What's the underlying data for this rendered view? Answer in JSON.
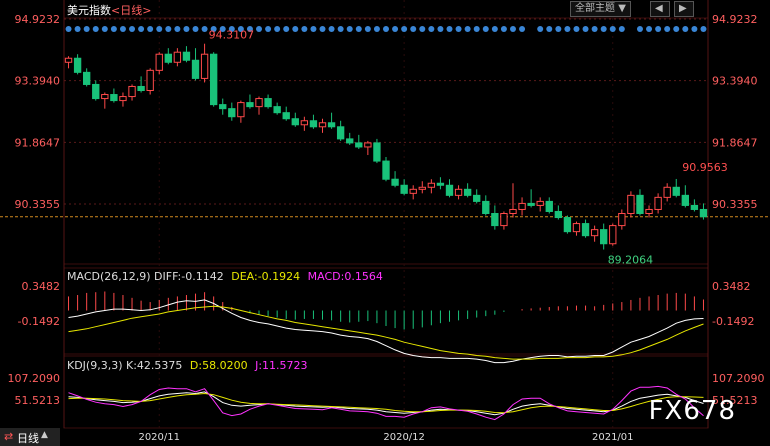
{
  "header": {
    "title": "美元指数",
    "period": "<日线>",
    "theme_button": "全部主题",
    "theme_arrow": "▼"
  },
  "period_tab": "日线",
  "watermark": "FX678",
  "axis_dates": [
    "2020/11",
    "2020/12",
    "2021/01"
  ],
  "price_panel": {
    "ticks": [
      "94.9232",
      "93.3940",
      "91.8647",
      "90.3355"
    ],
    "ymax_label": 94.9232,
    "ymin_label": 90.3355,
    "high_label": "94.3107",
    "high_value": 94.3107,
    "low_label": "89.2064",
    "low_value": 89.2064,
    "recent_high_label": "90.9563",
    "recent_high_value": 90.9563,
    "last_close": 90.02
  },
  "macd_panel": {
    "title": "MACD(26,12,9)",
    "diff_label": "DIFF:-0.1142",
    "dea_label": "DEA:-0.1924",
    "macd_label": "MACD:0.1564",
    "ticks": [
      "0.3482",
      "-0.1492"
    ]
  },
  "kdj_panel": {
    "title": "KDJ(9,3,3)",
    "k_label": "K:42.5375",
    "d_label": "D:58.0200",
    "j_label": "J:11.5723",
    "ticks": [
      "107.2090",
      "51.5213"
    ]
  },
  "colors": {
    "up": "#ff4a4a",
    "down": "#19c27a",
    "axis_text": "#ff5f5f",
    "grid": "#5a1a1a",
    "diff": "#ffffff",
    "dea": "#e6e600",
    "macd": "#ff33ff",
    "marker": "#3a86d6"
  },
  "chart_data": {
    "type": "candlestick",
    "title": "美元指数 日线",
    "xlabel": "",
    "ylabel": "",
    "ylim": [
      89.0,
      94.92
    ],
    "x_ticks": [
      "2020/11",
      "2020/12",
      "2021/01"
    ],
    "ohlc": [
      [
        93.85,
        94.0,
        93.7,
        93.95
      ],
      [
        93.95,
        94.05,
        93.55,
        93.6
      ],
      [
        93.6,
        93.7,
        93.25,
        93.3
      ],
      [
        93.3,
        93.4,
        92.9,
        92.95
      ],
      [
        92.95,
        93.1,
        92.7,
        93.05
      ],
      [
        93.05,
        93.2,
        92.85,
        92.9
      ],
      [
        92.9,
        93.1,
        92.75,
        93.0
      ],
      [
        93.0,
        93.3,
        92.9,
        93.25
      ],
      [
        93.25,
        93.5,
        93.1,
        93.15
      ],
      [
        93.15,
        93.7,
        93.05,
        93.65
      ],
      [
        93.65,
        94.1,
        93.55,
        94.05
      ],
      [
        94.05,
        94.2,
        93.8,
        93.85
      ],
      [
        93.85,
        94.2,
        93.75,
        94.1
      ],
      [
        94.1,
        94.25,
        93.85,
        93.9
      ],
      [
        93.9,
        94.2,
        93.4,
        93.45
      ],
      [
        93.45,
        94.3107,
        93.35,
        94.05
      ],
      [
        94.05,
        94.1,
        92.75,
        92.8
      ],
      [
        92.8,
        92.95,
        92.55,
        92.7
      ],
      [
        92.7,
        92.85,
        92.4,
        92.5
      ],
      [
        92.5,
        92.9,
        92.35,
        92.85
      ],
      [
        92.85,
        93.05,
        92.7,
        92.75
      ],
      [
        92.75,
        93.0,
        92.55,
        92.95
      ],
      [
        92.95,
        93.05,
        92.7,
        92.75
      ],
      [
        92.75,
        92.85,
        92.55,
        92.6
      ],
      [
        92.6,
        92.75,
        92.4,
        92.45
      ],
      [
        92.45,
        92.6,
        92.25,
        92.3
      ],
      [
        92.3,
        92.5,
        92.15,
        92.4
      ],
      [
        92.4,
        92.55,
        92.2,
        92.25
      ],
      [
        92.25,
        92.45,
        92.1,
        92.35
      ],
      [
        92.35,
        92.6,
        92.2,
        92.25
      ],
      [
        92.25,
        92.4,
        91.9,
        91.95
      ],
      [
        91.95,
        92.1,
        91.8,
        91.85
      ],
      [
        91.85,
        92.05,
        91.7,
        91.75
      ],
      [
        91.75,
        91.9,
        91.55,
        91.85
      ],
      [
        91.85,
        91.95,
        91.35,
        91.4
      ],
      [
        91.4,
        91.5,
        90.9,
        90.95
      ],
      [
        90.95,
        91.15,
        90.75,
        90.8
      ],
      [
        90.8,
        90.95,
        90.55,
        90.6
      ],
      [
        90.6,
        90.8,
        90.45,
        90.7
      ],
      [
        90.7,
        90.9,
        90.6,
        90.75
      ],
      [
        90.75,
        90.95,
        90.6,
        90.85
      ],
      [
        90.85,
        91.0,
        90.7,
        90.8
      ],
      [
        90.8,
        90.95,
        90.5,
        90.55
      ],
      [
        90.55,
        90.8,
        90.45,
        90.7
      ],
      [
        90.7,
        90.85,
        90.5,
        90.55
      ],
      [
        90.55,
        90.7,
        90.35,
        90.4
      ],
      [
        90.4,
        90.55,
        90.05,
        90.1
      ],
      [
        90.1,
        90.3,
        89.7,
        89.8
      ],
      [
        89.8,
        90.15,
        89.7,
        90.1
      ],
      [
        90.1,
        90.85,
        90.0,
        90.2
      ],
      [
        90.2,
        90.5,
        90.05,
        90.35
      ],
      [
        90.35,
        90.7,
        90.25,
        90.3
      ],
      [
        90.3,
        90.5,
        90.15,
        90.4
      ],
      [
        90.4,
        90.5,
        90.1,
        90.15
      ],
      [
        90.15,
        90.3,
        89.95,
        90.0
      ],
      [
        90.0,
        90.05,
        89.6,
        89.65
      ],
      [
        89.65,
        89.9,
        89.55,
        89.85
      ],
      [
        89.85,
        89.95,
        89.5,
        89.55
      ],
      [
        89.55,
        89.8,
        89.4,
        89.7
      ],
      [
        89.7,
        89.85,
        89.2064,
        89.35
      ],
      [
        89.35,
        89.85,
        89.3,
        89.8
      ],
      [
        89.8,
        90.2,
        89.7,
        90.1
      ],
      [
        90.1,
        90.65,
        90.0,
        90.55
      ],
      [
        90.55,
        90.7,
        90.05,
        90.1
      ],
      [
        90.1,
        90.3,
        90.0,
        90.2
      ],
      [
        90.2,
        90.6,
        90.1,
        90.5
      ],
      [
        90.5,
        90.85,
        90.4,
        90.75
      ],
      [
        90.75,
        90.9563,
        90.5,
        90.55
      ],
      [
        90.55,
        90.8,
        90.25,
        90.3
      ],
      [
        90.3,
        90.45,
        90.15,
        90.2
      ],
      [
        90.2,
        90.35,
        89.95,
        90.02
      ]
    ],
    "macd_hist": [
      0.2,
      0.22,
      0.25,
      0.26,
      0.27,
      0.25,
      0.22,
      0.18,
      0.14,
      0.12,
      0.15,
      0.18,
      0.2,
      0.22,
      0.24,
      0.26,
      0.2,
      0.12,
      0.05,
      0.0,
      -0.04,
      -0.06,
      -0.08,
      -0.1,
      -0.12,
      -0.13,
      -0.12,
      -0.12,
      -0.13,
      -0.14,
      -0.16,
      -0.17,
      -0.16,
      -0.15,
      -0.18,
      -0.22,
      -0.25,
      -0.27,
      -0.26,
      -0.24,
      -0.21,
      -0.18,
      -0.16,
      -0.14,
      -0.12,
      -0.1,
      -0.08,
      -0.06,
      -0.02,
      0.0,
      0.02,
      0.03,
      0.04,
      0.05,
      0.06,
      0.06,
      0.07,
      0.07,
      0.06,
      0.08,
      0.1,
      0.12,
      0.15,
      0.18,
      0.2,
      0.22,
      0.24,
      0.25,
      0.24,
      0.2,
      0.1564
    ],
    "diff": [
      -0.1,
      -0.08,
      -0.05,
      -0.02,
      0.0,
      0.02,
      0.02,
      0.01,
      0.0,
      0.01,
      0.04,
      0.08,
      0.12,
      0.14,
      0.13,
      0.15,
      0.1,
      0.03,
      -0.04,
      -0.1,
      -0.14,
      -0.17,
      -0.19,
      -0.22,
      -0.25,
      -0.27,
      -0.28,
      -0.29,
      -0.3,
      -0.32,
      -0.35,
      -0.37,
      -0.38,
      -0.4,
      -0.44,
      -0.5,
      -0.56,
      -0.61,
      -0.64,
      -0.66,
      -0.67,
      -0.67,
      -0.68,
      -0.68,
      -0.68,
      -0.69,
      -0.71,
      -0.74,
      -0.74,
      -0.72,
      -0.69,
      -0.67,
      -0.65,
      -0.64,
      -0.64,
      -0.66,
      -0.65,
      -0.65,
      -0.64,
      -0.64,
      -0.59,
      -0.52,
      -0.45,
      -0.41,
      -0.37,
      -0.31,
      -0.25,
      -0.18,
      -0.14,
      -0.12,
      -0.1142
    ],
    "dea": [
      -0.3,
      -0.28,
      -0.26,
      -0.23,
      -0.2,
      -0.17,
      -0.14,
      -0.11,
      -0.09,
      -0.07,
      -0.05,
      -0.02,
      0.0,
      0.02,
      0.04,
      0.05,
      0.06,
      0.05,
      0.03,
      0.0,
      -0.03,
      -0.06,
      -0.09,
      -0.12,
      -0.14,
      -0.17,
      -0.19,
      -0.21,
      -0.23,
      -0.25,
      -0.27,
      -0.29,
      -0.31,
      -0.33,
      -0.35,
      -0.38,
      -0.41,
      -0.45,
      -0.48,
      -0.51,
      -0.54,
      -0.57,
      -0.59,
      -0.61,
      -0.62,
      -0.64,
      -0.65,
      -0.67,
      -0.68,
      -0.69,
      -0.69,
      -0.69,
      -0.68,
      -0.68,
      -0.68,
      -0.67,
      -0.67,
      -0.67,
      -0.66,
      -0.66,
      -0.65,
      -0.63,
      -0.6,
      -0.56,
      -0.51,
      -0.46,
      -0.41,
      -0.35,
      -0.29,
      -0.24,
      -0.1924
    ],
    "k": [
      60,
      58,
      55,
      52,
      50,
      48,
      45,
      46,
      48,
      55,
      62,
      66,
      68,
      70,
      68,
      72,
      60,
      45,
      38,
      36,
      38,
      40,
      42,
      40,
      38,
      36,
      35,
      34,
      33,
      34,
      32,
      30,
      29,
      28,
      26,
      22,
      20,
      18,
      20,
      22,
      26,
      28,
      27,
      26,
      25,
      22,
      18,
      14,
      18,
      28,
      36,
      40,
      42,
      38,
      34,
      30,
      28,
      26,
      24,
      22,
      26,
      36,
      48,
      56,
      60,
      64,
      66,
      62,
      58,
      50,
      42.5375
    ],
    "d": [
      55,
      56,
      56,
      55,
      54,
      52,
      50,
      49,
      48,
      50,
      54,
      58,
      62,
      65,
      66,
      68,
      65,
      58,
      51,
      46,
      43,
      42,
      42,
      41,
      40,
      39,
      38,
      37,
      36,
      35,
      34,
      33,
      32,
      31,
      30,
      28,
      25,
      23,
      22,
      22,
      23,
      25,
      26,
      26,
      26,
      25,
      23,
      20,
      19,
      22,
      27,
      32,
      35,
      36,
      35,
      33,
      31,
      29,
      27,
      25,
      25,
      29,
      35,
      42,
      48,
      53,
      58,
      60,
      60,
      59,
      58.02
    ],
    "j": [
      70,
      62,
      53,
      46,
      42,
      40,
      35,
      40,
      48,
      65,
      78,
      82,
      80,
      80,
      72,
      80,
      50,
      19,
      12,
      16,
      28,
      36,
      42,
      38,
      34,
      30,
      29,
      28,
      27,
      32,
      28,
      24,
      23,
      22,
      18,
      10,
      10,
      8,
      16,
      22,
      32,
      34,
      29,
      26,
      23,
      16,
      8,
      2,
      16,
      40,
      54,
      56,
      56,
      42,
      32,
      24,
      22,
      20,
      18,
      16,
      28,
      50,
      74,
      84,
      84,
      86,
      82,
      66,
      54,
      32,
      11.5723
    ]
  }
}
